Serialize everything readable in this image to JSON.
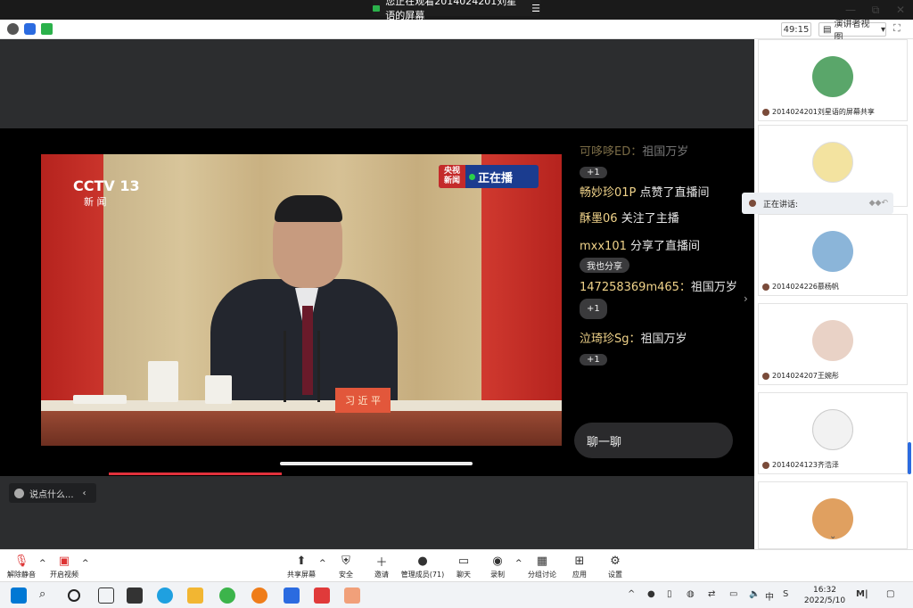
{
  "banner": {
    "text": "您正在观看2014024201刘星语的屏幕"
  },
  "window": {
    "minimize": "—",
    "restore": "⧉",
    "close": "✕"
  },
  "toolbar": {
    "timer": "49:15",
    "view_label": "演讲者视图"
  },
  "broadcast": {
    "channel": "CCTV 13",
    "channel_sub": "新 闻",
    "live_brand_top": "央视",
    "live_brand_bottom": "新闻",
    "live_label": "正在播",
    "nameplate": "习 近 平"
  },
  "chat": {
    "messages": [
      {
        "user": "可哆哆ED：",
        "text": "祖国万岁",
        "chip": "+1"
      },
      {
        "user": "畅妙珍01P",
        "text": "点赞了直播间",
        "chip": ""
      },
      {
        "user": "酥墨06",
        "text": "关注了主播",
        "chip": ""
      },
      {
        "user": "mxx101",
        "text": "分享了直播间",
        "chip": "我也分享"
      },
      {
        "user": "147258369m465：",
        "text": "祖国万岁",
        "chip": "+1"
      },
      {
        "user": "泣琦珍Sg：",
        "text": "祖国万岁",
        "chip": "+1"
      }
    ],
    "input_label": "聊一聊"
  },
  "comment_box": {
    "placeholder": "说点什么..."
  },
  "speaking": {
    "label": "正在讲话:"
  },
  "participants": [
    {
      "name": "2014024201刘星语的屏幕共享",
      "color": "#5aa66a"
    },
    {
      "name": "",
      "color": "#f3e3a0"
    },
    {
      "name": "2014024226慕杨帆",
      "color": "#8bb5d9"
    },
    {
      "name": "2014024207王婉彤",
      "color": "#e9d2c6"
    },
    {
      "name": "2014024123齐浩泽",
      "color": "#f2f2f2"
    },
    {
      "name": "",
      "color": "#e0a060"
    }
  ],
  "controls": [
    {
      "label": "解除静音",
      "icon": "mic-muted-icon"
    },
    {
      "label": "开启视频",
      "icon": "video-off-icon"
    },
    {
      "label": "共享屏幕",
      "icon": "share-screen-icon"
    },
    {
      "label": "安全",
      "icon": "shield-icon"
    },
    {
      "label": "邀请",
      "icon": "invite-icon"
    },
    {
      "label": "管理成员(71)",
      "icon": "members-icon"
    },
    {
      "label": "聊天",
      "icon": "chat-icon"
    },
    {
      "label": "录制",
      "icon": "record-icon"
    },
    {
      "label": "分组讨论",
      "icon": "breakout-icon"
    },
    {
      "label": "应用",
      "icon": "apps-icon"
    },
    {
      "label": "设置",
      "icon": "gear-icon"
    }
  ],
  "taskbar": {
    "time": "16:32",
    "date": "2022/5/10",
    "ime": "中"
  }
}
